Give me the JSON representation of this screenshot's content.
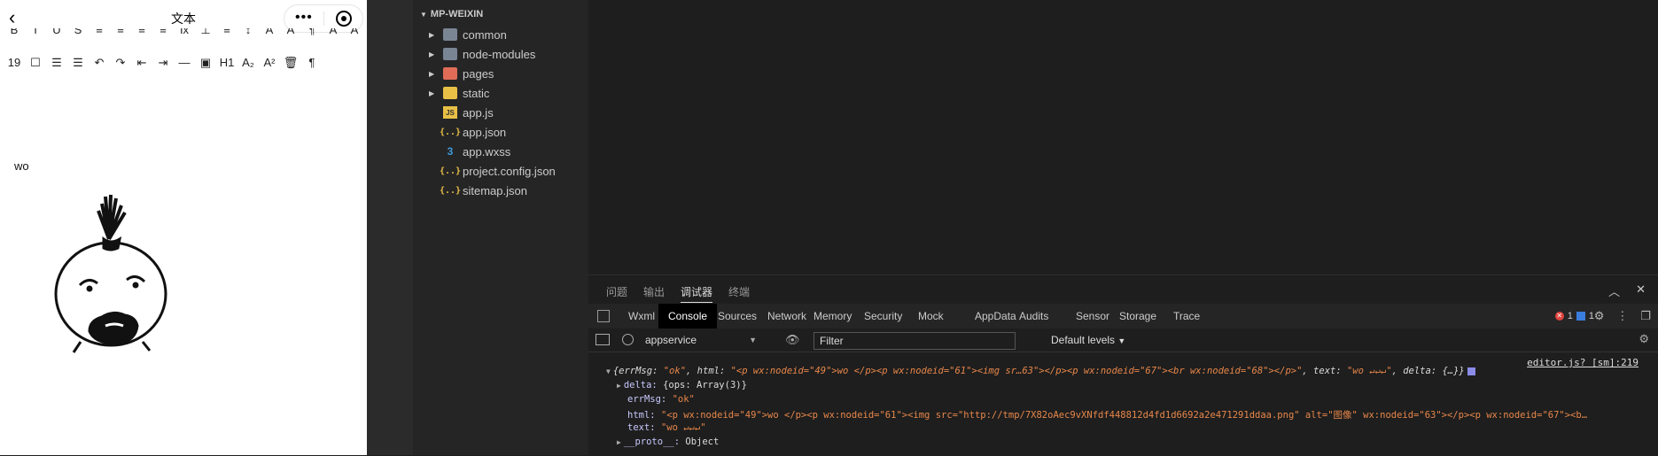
{
  "simulator": {
    "nav_title": "文本",
    "capsule_dots": "•••",
    "toolbar_row1": [
      "B",
      "I",
      "U",
      "S",
      "≡",
      "≡",
      "≡",
      "≡",
      "Ix",
      "⊥",
      "≡",
      "↕",
      "A",
      "A",
      "¶",
      "A",
      "A"
    ],
    "toolbar_row2": [
      "19",
      "☐",
      "☰",
      "☰",
      "↶",
      "↷",
      "⇤",
      "⇥",
      "—",
      "▣",
      "H1",
      "A₂",
      "A²",
      "🗑",
      "¶"
    ],
    "editor_text": "wo"
  },
  "explorer": {
    "header": "MP-WEIXIN",
    "items": [
      {
        "label": "common",
        "kind": "folder",
        "icon": "folder-icon"
      },
      {
        "label": "node-modules",
        "kind": "folder",
        "icon": "folder-icon"
      },
      {
        "label": "pages",
        "kind": "folder",
        "icon": "pages-folder-icon"
      },
      {
        "label": "static",
        "kind": "folder",
        "icon": "static-folder-icon"
      },
      {
        "label": "app.js",
        "kind": "file",
        "icon": "js-file-icon"
      },
      {
        "label": "app.json",
        "kind": "file",
        "icon": "json-file-icon"
      },
      {
        "label": "app.wxss",
        "kind": "file",
        "icon": "wxss-file-icon"
      },
      {
        "label": "project.config.json",
        "kind": "file",
        "icon": "json-file-icon"
      },
      {
        "label": "sitemap.json",
        "kind": "file",
        "icon": "json-file-icon"
      }
    ]
  },
  "panel": {
    "tabs": [
      "问题",
      "输出",
      "调试器",
      "终端"
    ],
    "active_tab": "调试器"
  },
  "devtools": {
    "tabs": [
      "Wxml",
      "Console",
      "Sources",
      "Network",
      "Memory",
      "Security",
      "Mock",
      "AppData",
      "Audits",
      "Sensor",
      "Storage",
      "Trace"
    ],
    "active": "Console",
    "error_count": "1",
    "info_count": "1",
    "context": "appservice",
    "filter_placeholder": "Filter",
    "levels": "Default levels"
  },
  "console": {
    "source": "editor.js? [sm]:219",
    "summary_open": "{errMsg: ",
    "errmsg_val": "\"ok\"",
    "html_key": ", html: ",
    "html_short": "\"<p wx:nodeid=\"49\">wo </p><p wx:nodeid=\"61\"><img sr…63\"></p><p wx:nodeid=\"67\"><br wx:nodeid=\"68\"></p>\"",
    "text_key": ", text: ",
    "text_short": "\"wo ↵↵↵\"",
    "delta_key": ", delta: ",
    "delta_short": "{…}}",
    "delta_line_key": "delta: ",
    "delta_line_val": "{ops: Array(3)}",
    "errmsg_line_key": "errMsg: ",
    "errmsg_line_val": "\"ok\"",
    "html_line_key": "html: ",
    "html_line_val": "\"<p wx:nodeid=\"49\">wo </p><p wx:nodeid=\"61\"><img src=\"http://tmp/7X82oAec9vXNfdf448812d4fd1d6692a2e471291ddaa.png\" alt=\"图像\" wx:nodeid=\"63\"></p><p wx:nodeid=\"67\"><b…",
    "text_line_key": "text: ",
    "text_line_val": "\"wo ↵↵↵\"",
    "proto_line_key": "__proto__: ",
    "proto_line_val": "Object"
  },
  "colors": {
    "string": "#e8874a",
    "error": "#e0443e",
    "info": "#3b7ddd"
  }
}
